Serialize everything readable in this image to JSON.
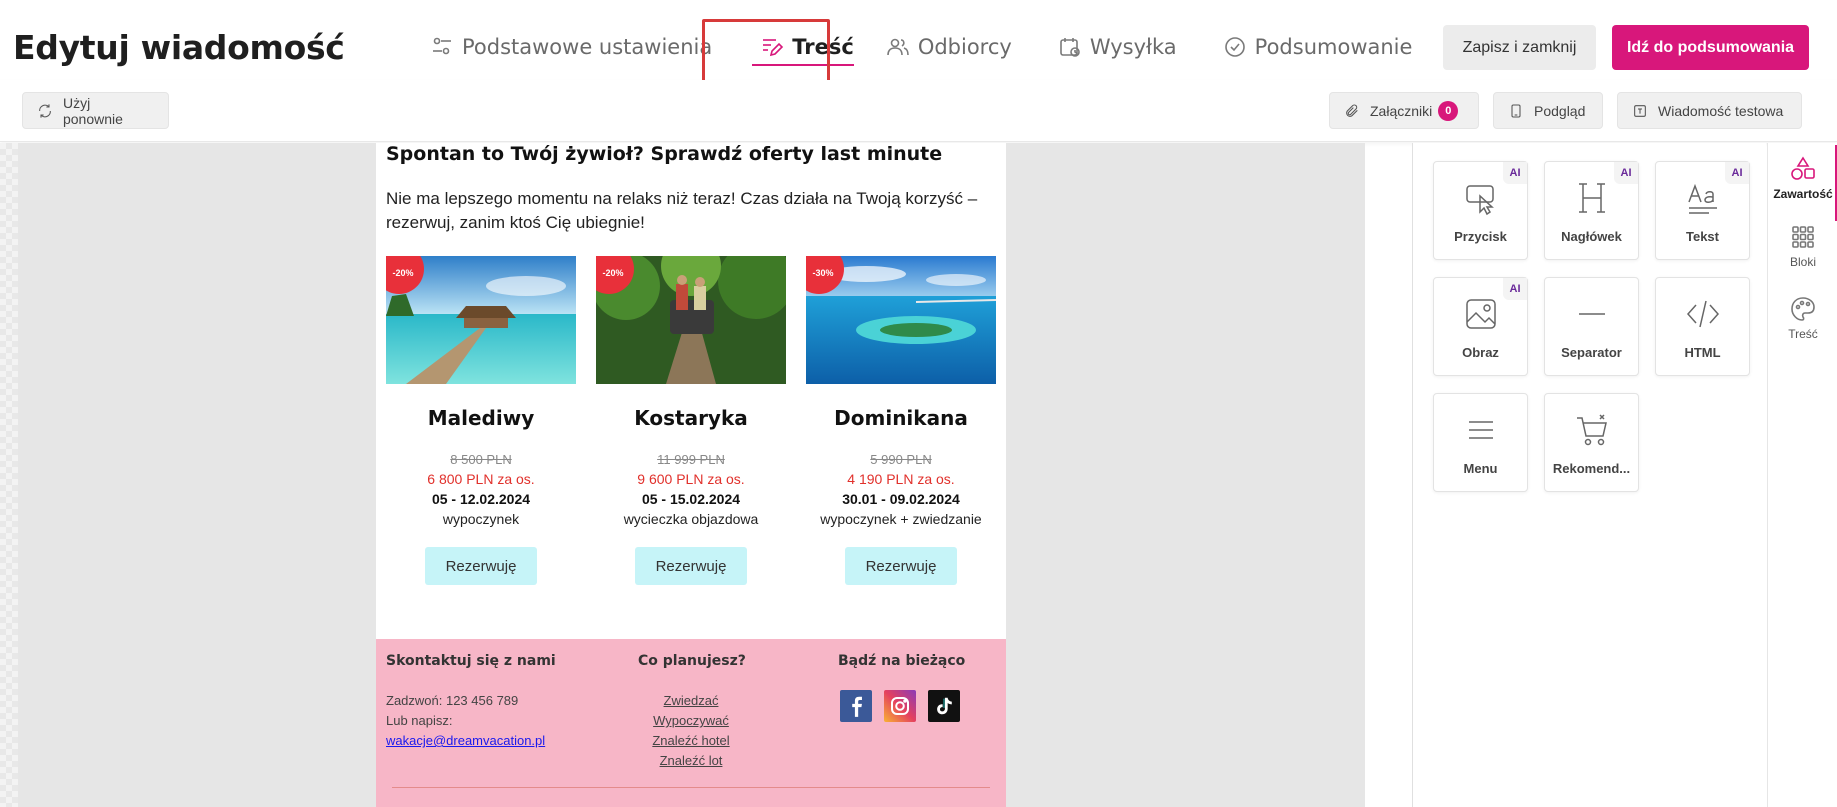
{
  "header": {
    "title": "Edytuj wiadomość",
    "steps": [
      {
        "label": "Podstawowe ustawienia",
        "icon": "sliders-icon"
      },
      {
        "label": "Treść",
        "icon": "edit-content-icon",
        "active": true
      },
      {
        "label": "Odbiorcy",
        "icon": "users-icon"
      },
      {
        "label": "Wysyłka",
        "icon": "calendar-clock-icon"
      },
      {
        "label": "Podsumowanie",
        "icon": "check-circle-icon"
      }
    ],
    "save_label": "Zapisz i zamknij",
    "summary_label": "Idź do podsumowania"
  },
  "toolbar": {
    "reuse_label": "Użyj ponownie",
    "attachments_label": "Załączniki",
    "attachments_count": "0",
    "preview_label": "Podgląd",
    "test_label": "Wiadomość testowa"
  },
  "email": {
    "heading": "Spontan to Twój żywioł? Sprawdź oferty last minute",
    "lead": "Nie ma lepszego momentu na relaks niż teraz! Czas działa na Twoją korzyść – rezerwuj, zanim ktoś Cię ubiegnie!",
    "offers": [
      {
        "discount": "-20%",
        "name": "Malediwy",
        "old_price": "8 500 PLN",
        "new_price": "6 800 PLN za os.",
        "dates": "05 - 12.02.2024",
        "kind": "wypoczynek",
        "cta": "Rezerwuję"
      },
      {
        "discount": "-20%",
        "name": "Kostaryka",
        "old_price": "11 999 PLN",
        "new_price": "9 600 PLN za os.",
        "dates": "05 - 15.02.2024",
        "kind": "wycieczka objazdowa",
        "cta": "Rezerwuję"
      },
      {
        "discount": "-30%",
        "name": "Dominikana",
        "old_price": "5 990 PLN",
        "new_price": "4 190 PLN za os.",
        "dates": "30.01 - 09.02.2024",
        "kind": "wypoczynek + zwiedzanie",
        "cta": "Rezerwuję"
      }
    ],
    "footer": {
      "contact_title": "Skontaktuj się z nami",
      "phone": "Zadzwoń: 123 456 789",
      "write": "Lub napisz:",
      "email": "wakacje@dreamvacation.pl",
      "plan_title": "Co planujesz?",
      "plan_links": [
        "Zwiedzać",
        "Wypoczywać",
        "Znaleźć hotel",
        "Znaleźć lot"
      ],
      "social_title": "Bądź na bieżąco",
      "social": [
        "facebook-icon",
        "instagram-icon",
        "tiktok-icon"
      ]
    }
  },
  "panel": {
    "tiles": [
      {
        "label": "Przycisk",
        "icon": "button-cursor-icon",
        "ai": "AI"
      },
      {
        "label": "Nagłówek",
        "icon": "heading-icon",
        "ai": "AI"
      },
      {
        "label": "Tekst",
        "icon": "text-icon",
        "ai": "AI"
      },
      {
        "label": "Obraz",
        "icon": "image-icon",
        "ai": "AI"
      },
      {
        "label": "Separator",
        "icon": "separator-icon"
      },
      {
        "label": "HTML",
        "icon": "code-icon"
      },
      {
        "label": "Menu",
        "icon": "menu-icon"
      },
      {
        "label": "Rekomend...",
        "icon": "cart-icon"
      }
    ]
  },
  "sidenav": {
    "items": [
      {
        "label": "Zawartość",
        "icon": "shapes-icon",
        "active": true
      },
      {
        "label": "Bloki",
        "icon": "grid-icon"
      },
      {
        "label": "Treść",
        "icon": "palette-icon"
      }
    ]
  },
  "colors": {
    "brand": "#d8177b",
    "footer_bg": "#f7b6c7",
    "cta_bg": "#c6f4f8",
    "price_red": "#e1302b"
  }
}
